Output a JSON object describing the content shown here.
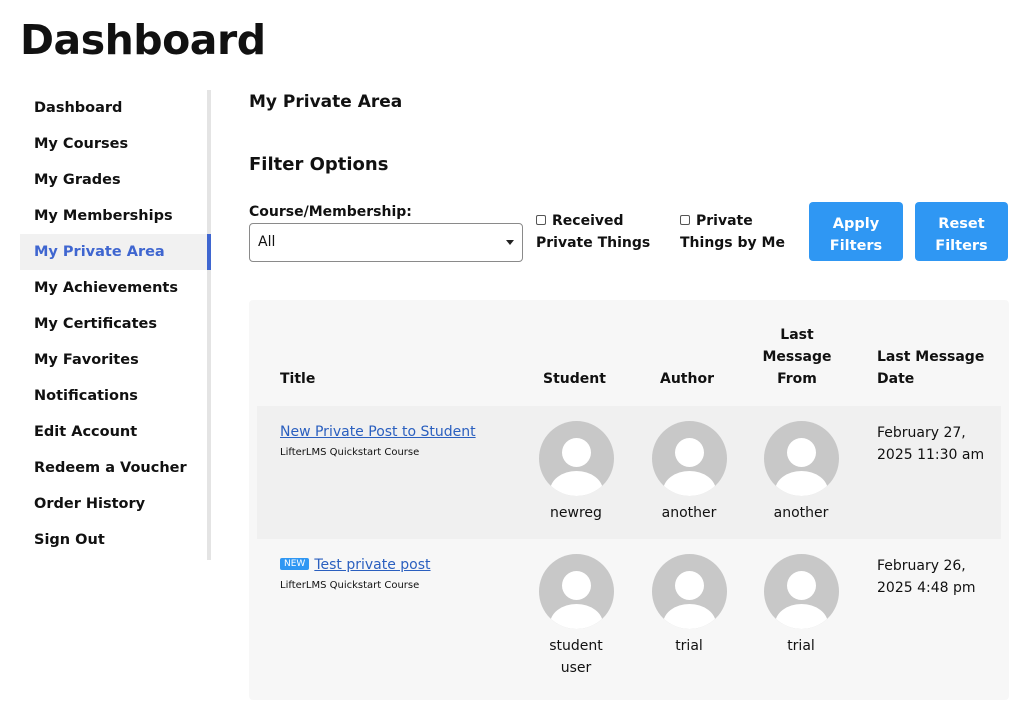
{
  "page": {
    "title": "Dashboard"
  },
  "sidebar": {
    "items": [
      {
        "label": "Dashboard"
      },
      {
        "label": "My Courses"
      },
      {
        "label": "My Grades"
      },
      {
        "label": "My Memberships"
      },
      {
        "label": "My Private Area",
        "active": true
      },
      {
        "label": "My Achievements"
      },
      {
        "label": "My Certificates"
      },
      {
        "label": "My Favorites"
      },
      {
        "label": "Notifications"
      },
      {
        "label": "Edit Account"
      },
      {
        "label": "Redeem a Voucher"
      },
      {
        "label": "Order History"
      },
      {
        "label": "Sign Out"
      }
    ]
  },
  "main": {
    "section_title": "My Private Area",
    "filter_title": "Filter Options",
    "filter": {
      "course_label": "Course/Membership:",
      "course_selected": "All",
      "received_line1": "Received",
      "received_line2": "Private Things",
      "by_me_line1": "Private",
      "by_me_line2": "Things by Me",
      "apply_line1": "Apply",
      "apply_line2": "Filters",
      "reset_line1": "Reset",
      "reset_line2": "Filters"
    },
    "table": {
      "headers": {
        "title": "Title",
        "student": "Student",
        "author": "Author",
        "last_from_1": "Last",
        "last_from_2": "Message",
        "last_from_3": "From",
        "last_date_1": "Last Message",
        "last_date_2": "Date"
      },
      "rows": [
        {
          "title": "New Private Post to Student",
          "course": "LifterLMS Quickstart Course",
          "badge": "",
          "student_1": "newreg",
          "student_2": "",
          "author": "another",
          "last_from": "another",
          "date_1": "February 27,",
          "date_2": "2025 11:30 am"
        },
        {
          "title": "Test private post",
          "course": "LifterLMS Quickstart Course",
          "badge": "NEW",
          "student_1": "student",
          "student_2": "user",
          "author": "trial",
          "last_from": "trial",
          "date_1": "February 26,",
          "date_2": "2025 4:48 pm"
        }
      ]
    }
  },
  "colors": {
    "accent": "#3f66d0",
    "button": "#2f97f3",
    "link": "#2a5fbf",
    "avatar": "#c8c8c8"
  }
}
